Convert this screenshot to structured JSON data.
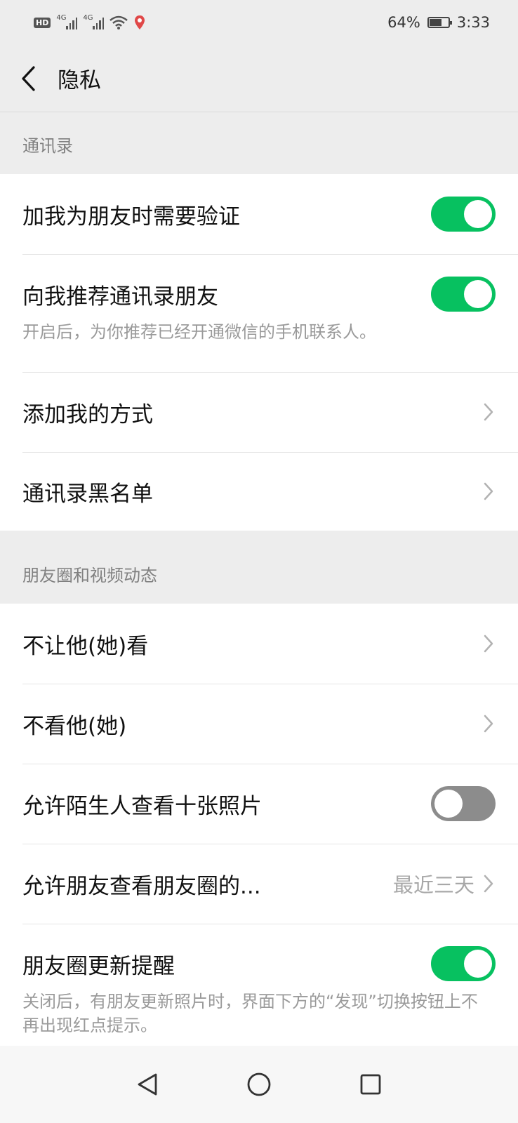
{
  "status_bar": {
    "network_badge": "HD",
    "signal1": "4G",
    "signal2": "4G",
    "battery_percent": "64%",
    "battery_level": 0.64,
    "time": "3:33"
  },
  "header": {
    "title": "隐私"
  },
  "contacts_section": {
    "title": "通讯录",
    "items": [
      {
        "label": "加我为朋友时需要验证",
        "toggle": "on"
      },
      {
        "label": "向我推荐通讯录朋友",
        "toggle": "on",
        "description": "开启后，为你推荐已经开通微信的手机联系人。"
      },
      {
        "label": "添加我的方式"
      },
      {
        "label": "通讯录黑名单"
      }
    ]
  },
  "moments_section": {
    "title": "朋友圈和视频动态",
    "items": [
      {
        "label": "不让他(她)看"
      },
      {
        "label": "不看他(她)"
      },
      {
        "label": "允许陌生人查看十张照片",
        "toggle": "off"
      },
      {
        "label": "允许朋友查看朋友圈的...",
        "value": "最近三天"
      },
      {
        "label": "朋友圈更新提醒",
        "toggle": "on",
        "description": "关闭后，有朋友更新照片时，界面下方的“发现”切换按钮上不再出现红点提示。"
      }
    ]
  },
  "colors": {
    "accent_green": "#07c160",
    "toggle_off": "#8c8c8c"
  },
  "system_nav": [
    "back-icon",
    "home-icon",
    "recents-icon"
  ]
}
